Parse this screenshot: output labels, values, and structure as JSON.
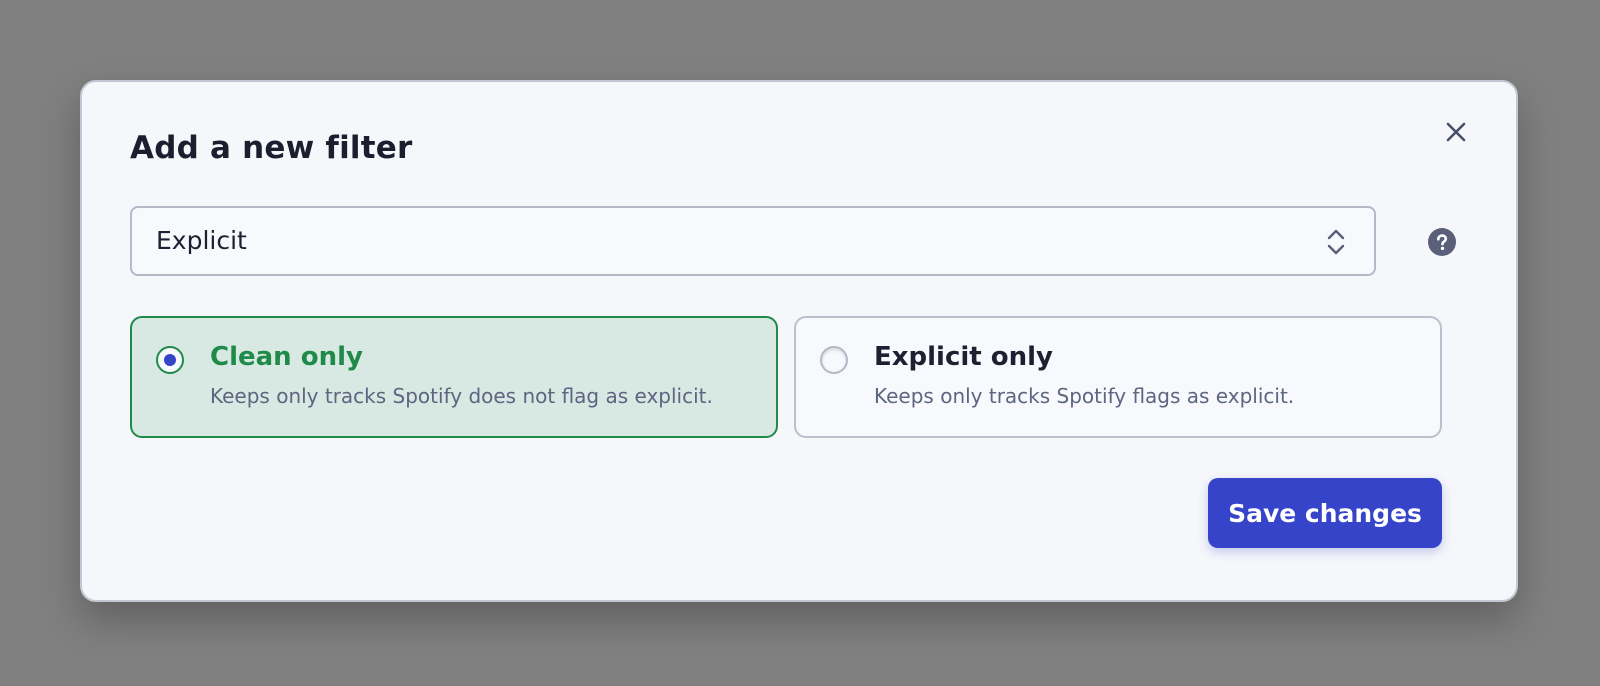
{
  "dialog": {
    "title": "Add a new filter",
    "close_icon": "close-icon",
    "help_icon": "question-circle-icon"
  },
  "filter_select": {
    "selected_value": "Explicit",
    "icon": "chevron-up-down-icon"
  },
  "options": [
    {
      "title": "Clean only",
      "description": "Keeps only tracks Spotify does not flag as explicit.",
      "selected": true
    },
    {
      "title": "Explicit only",
      "description": "Keeps only tracks Spotify flags as explicit.",
      "selected": false
    }
  ],
  "actions": {
    "save_label": "Save changes"
  },
  "colors": {
    "accent": "#3644c9",
    "selected_green": "#1f8a49",
    "selected_bg": "#d8e8e2",
    "backdrop": "#808081"
  }
}
